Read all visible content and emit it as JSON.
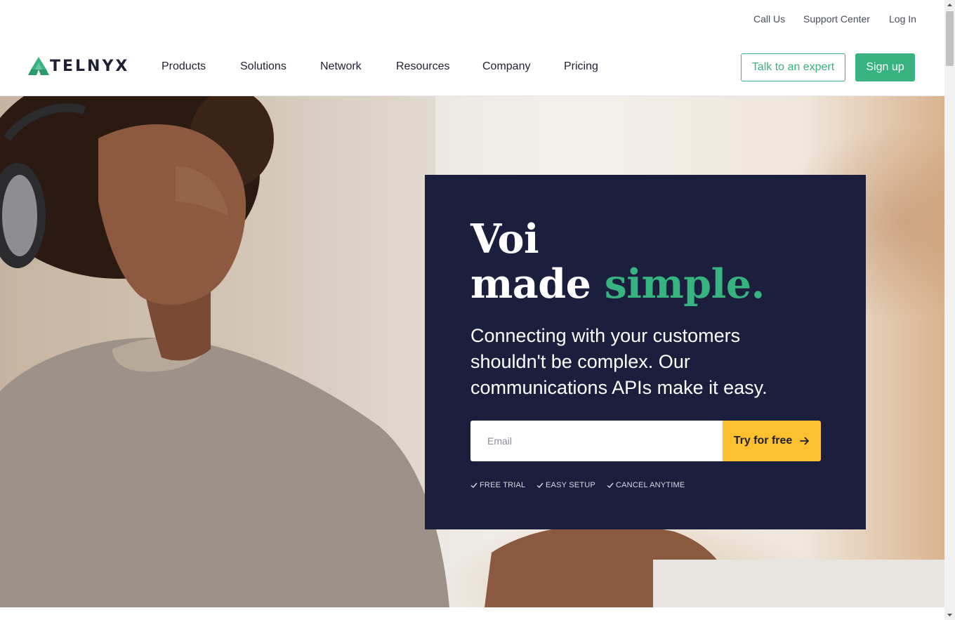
{
  "utility_nav": {
    "call_us": "Call Us",
    "support_center": "Support Center",
    "log_in": "Log In"
  },
  "brand": {
    "name": "TELNYX",
    "accent_color": "#36b37e",
    "logo_icon": "telnyx-logo-icon"
  },
  "main_nav": {
    "products": "Products",
    "solutions": "Solutions",
    "network": "Network",
    "resources": "Resources",
    "company": "Company",
    "pricing": "Pricing"
  },
  "actions": {
    "talk_to_expert": "Talk to an expert",
    "sign_up": "Sign up"
  },
  "hero": {
    "headline_line1": "Voi",
    "headline_line2_prefix": "made ",
    "headline_line2_accent": "simple.",
    "subtext": "Connecting with your customers shouldn't be complex. Our communications APIs make it easy.",
    "email_placeholder": "Email",
    "cta_label": "Try for free",
    "cta_icon": "arrow-right-icon",
    "cta_color": "#fdc02f",
    "card_color": "#1c1e3d",
    "benefits": [
      "FREE TRIAL",
      "EASY SETUP",
      "CANCEL ANYTIME"
    ],
    "benefit_icon": "check-icon",
    "background": "photo of a woman with headphones at a computer"
  }
}
